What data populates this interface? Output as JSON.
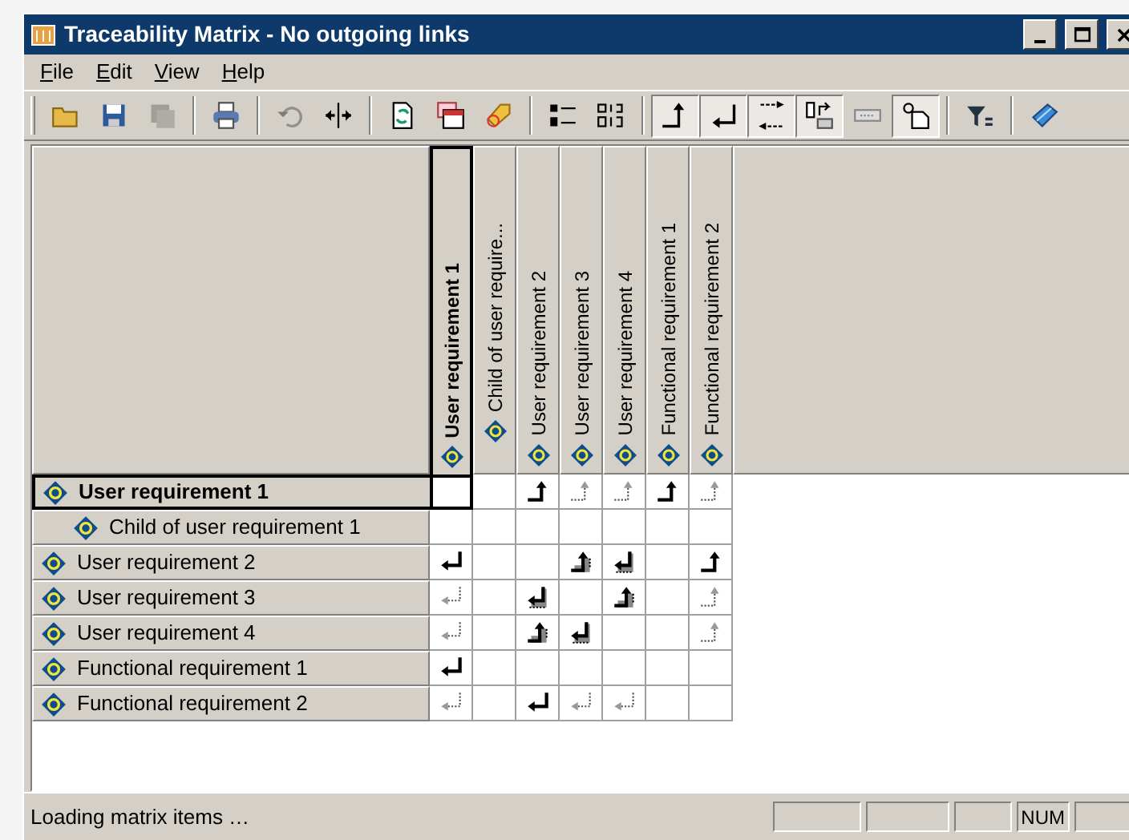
{
  "window": {
    "title": "Traceability Matrix - No outgoing links"
  },
  "menu": [
    "File",
    "Edit",
    "View",
    "Help"
  ],
  "toolbar": {
    "groups": [
      [
        {
          "pressed": false,
          "disabled": false
        },
        {
          "pressed": false,
          "disabled": false
        },
        {
          "pressed": false,
          "disabled": true
        }
      ],
      [
        {
          "pressed": false,
          "disabled": false
        }
      ],
      [
        {
          "pressed": false,
          "disabled": true
        },
        {
          "pressed": false,
          "disabled": false
        }
      ],
      [
        {
          "pressed": false,
          "disabled": false
        },
        {
          "pressed": false,
          "disabled": false
        },
        {
          "pressed": false,
          "disabled": false
        }
      ],
      [
        {
          "pressed": false,
          "disabled": false
        },
        {
          "pressed": false,
          "disabled": false
        }
      ],
      [
        {
          "pressed": true,
          "disabled": false
        },
        {
          "pressed": true,
          "disabled": false
        },
        {
          "pressed": true,
          "disabled": false
        },
        {
          "pressed": true,
          "disabled": false
        },
        {
          "pressed": false,
          "disabled": false
        },
        {
          "pressed": true,
          "disabled": false
        }
      ],
      [
        {
          "pressed": false,
          "disabled": false
        }
      ],
      [
        {
          "pressed": false,
          "disabled": false
        }
      ]
    ]
  },
  "matrix": {
    "columns": [
      {
        "label": "User requirement 1",
        "selected": true,
        "children": [
          {
            "label": "Child of user require...",
            "selected": false
          }
        ]
      },
      {
        "label": "User requirement 2",
        "selected": false
      },
      {
        "label": "User requirement 3",
        "selected": false
      },
      {
        "label": "User requirement 4",
        "selected": false
      },
      {
        "label": "Functional requirement 1",
        "selected": false
      },
      {
        "label": "Functional requirement 2",
        "selected": false
      }
    ],
    "rows": [
      {
        "label": "User requirement 1",
        "selected": true,
        "cells": [
          {
            "kind": "empty"
          },
          {
            "kind": "empty"
          },
          {
            "kind": "out"
          },
          {
            "kind": "out-dotted"
          },
          {
            "kind": "out-dotted"
          },
          {
            "kind": "out"
          },
          {
            "kind": "out-dotted"
          }
        ],
        "children": [
          {
            "label": "Child of user requirement 1",
            "selected": false,
            "cells": [
              {
                "kind": "empty"
              },
              {
                "kind": "empty"
              },
              {
                "kind": "empty"
              },
              {
                "kind": "empty"
              },
              {
                "kind": "empty"
              },
              {
                "kind": "empty"
              },
              {
                "kind": "empty"
              }
            ]
          }
        ]
      },
      {
        "label": "User requirement 2",
        "selected": false,
        "cells": [
          {
            "kind": "in"
          },
          {
            "kind": "empty"
          },
          {
            "kind": "empty"
          },
          {
            "kind": "both-out"
          },
          {
            "kind": "both-in"
          },
          {
            "kind": "empty"
          },
          {
            "kind": "out"
          }
        ]
      },
      {
        "label": "User requirement 3",
        "selected": false,
        "cells": [
          {
            "kind": "in-dotted"
          },
          {
            "kind": "empty"
          },
          {
            "kind": "both-in"
          },
          {
            "kind": "empty"
          },
          {
            "kind": "both-out"
          },
          {
            "kind": "empty"
          },
          {
            "kind": "out-dotted"
          }
        ]
      },
      {
        "label": "User requirement 4",
        "selected": false,
        "cells": [
          {
            "kind": "in-dotted"
          },
          {
            "kind": "empty"
          },
          {
            "kind": "both-out"
          },
          {
            "kind": "both-in"
          },
          {
            "kind": "empty"
          },
          {
            "kind": "empty"
          },
          {
            "kind": "out-dotted"
          }
        ]
      },
      {
        "label": "Functional requirement 1",
        "selected": false,
        "cells": [
          {
            "kind": "in"
          },
          {
            "kind": "empty"
          },
          {
            "kind": "empty"
          },
          {
            "kind": "empty"
          },
          {
            "kind": "empty"
          },
          {
            "kind": "empty"
          },
          {
            "kind": "empty"
          }
        ]
      },
      {
        "label": "Functional requirement 2",
        "selected": false,
        "cells": [
          {
            "kind": "in-dotted"
          },
          {
            "kind": "empty"
          },
          {
            "kind": "in"
          },
          {
            "kind": "in-dotted"
          },
          {
            "kind": "in-dotted"
          },
          {
            "kind": "empty"
          },
          {
            "kind": "empty"
          }
        ]
      }
    ]
  },
  "status_bar": {
    "text": "Loading matrix items …",
    "indicators": [
      "NUM"
    ]
  }
}
